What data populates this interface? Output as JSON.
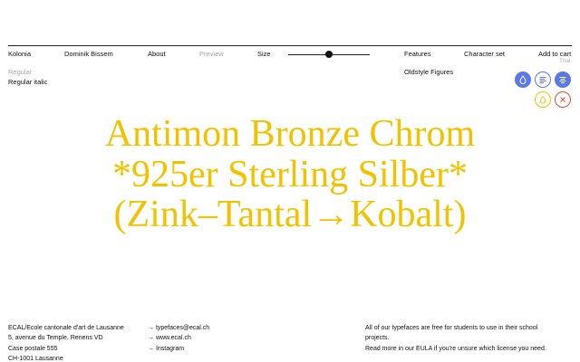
{
  "nav": {
    "typeface_name": "Kolonia",
    "designer": "Dominik Bissem",
    "about": "About",
    "preview": "Preview",
    "size_label": "Size",
    "size_level": 0.5,
    "features": "Features",
    "character_set": "Character set",
    "add_to_cart": "Add to cart",
    "trial": "Trial"
  },
  "styles": [
    "Regular",
    "Regular italic"
  ],
  "feature_option": "Oldstyle Figures",
  "tools": {
    "ink_icon": "ink-drop-icon",
    "align_left_icon": "align-left-icon",
    "align_center_icon": "align-center-icon",
    "reset_icon": "reset-icon",
    "close_icon": "close-icon",
    "colors": {
      "blue": "#5a78e6",
      "yellow": "#f2c200",
      "red": "#e0483a"
    }
  },
  "specimen": {
    "lines": [
      "Antimon Bronze Chrom",
      "*925er Sterling Silber*",
      "(Zink–Tantal→Kobalt)"
    ],
    "color": "#f2c200"
  },
  "footer": {
    "address": [
      "ECAL/Ecole cantonale d'art de Lausanne",
      "5, avenue du Temple, Renens VD",
      "Case postale 555",
      "CH-1001 Lausanne"
    ],
    "links": [
      "→ typefaces@ecal.ch",
      "→ www.ecal.ch",
      "→ Instagram"
    ],
    "license": [
      "All of our typefaces are free for students to use in their school",
      "projects.",
      "Read more in our EULA if you're unsure which license you need."
    ]
  }
}
